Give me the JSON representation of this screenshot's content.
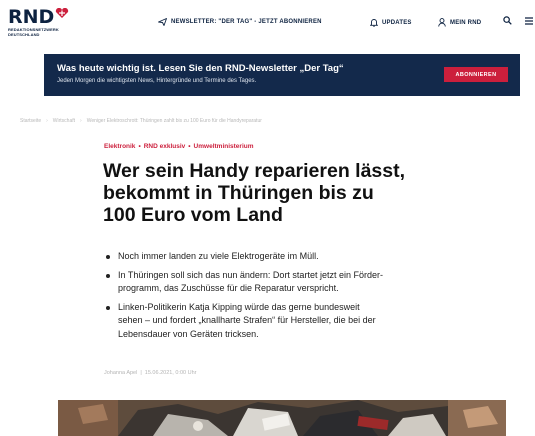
{
  "header": {
    "logo_text": "RND",
    "logo_subtitle": "REDAKTIONSNETZWERK DEUTSCHLAND",
    "nav": {
      "newsletter": "NEWSLETTER: \"DER TAG\" - JETZT ABONNIEREN",
      "updates": "UPDATES",
      "mein_rnd": "MEIN RND"
    },
    "icons": [
      "paper-plane-icon",
      "bell-icon",
      "user-icon",
      "search-icon",
      "menu-icon"
    ]
  },
  "banner": {
    "title": "Was heute wichtig ist. Lesen Sie den RND-Newsletter „Der Tag“",
    "text": "Jeden Morgen die wichtigsten News, Hintergründe und Termine des Tages.",
    "button": "ABONNIEREN"
  },
  "breadcrumb": [
    "Startseite",
    "Wirtschaft",
    "Weniger Elektroschrott: Thüringen zahlt bis zu 100 Euro für die Handyreparatur"
  ],
  "article": {
    "kicker": [
      "Elektronik",
      "RND exklusiv",
      "Umweltministerium"
    ],
    "headline_lines": [
      "Wer sein Handy reparieren lässt,",
      "bekommt in Thüringen bis zu",
      "100 Euro vom Land"
    ],
    "bullets": [
      [
        "Noch immer landen zu viele Elektrogeräte im Müll."
      ],
      [
        "In Thüringen soll sich das nun ändern: Dort startet jetzt ein Förder-",
        "programm, das Zuschüsse für die Reparatur verspricht."
      ],
      [
        "Linken-Politikerin Katja Kipping würde das gerne bundesweit",
        "sehen – und fordert „knallharte Strafen“ für Hersteller, die bei der",
        "Lebensdauer von Geräten tricksen."
      ]
    ],
    "author": "Johanna Apel",
    "date": "15.06.2021, 0:00 Uhr"
  },
  "colors": {
    "brand_navy": "#13294b",
    "accent_red": "#cc1f3c"
  }
}
